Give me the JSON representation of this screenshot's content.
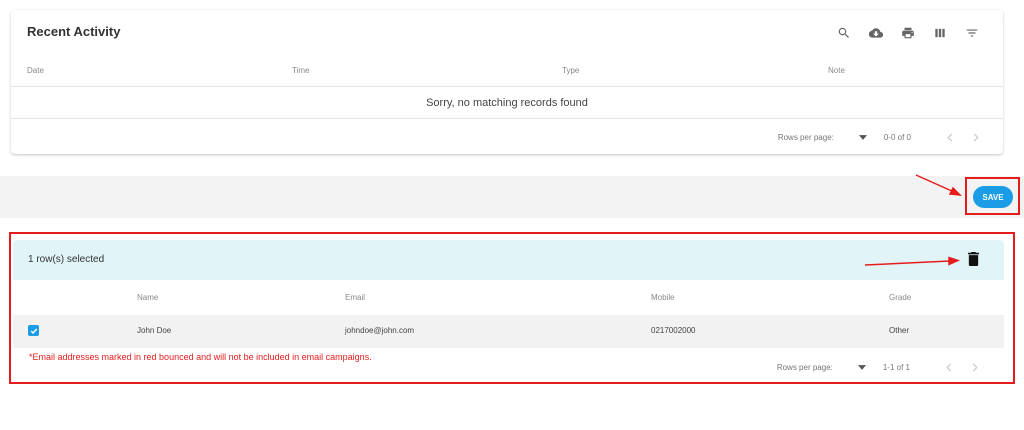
{
  "recent_activity": {
    "title": "Recent Activity",
    "toolbar_icons": [
      "search-icon",
      "cloud-download-icon",
      "print-icon",
      "view-columns-icon",
      "filter-icon"
    ],
    "columns": [
      "Date",
      "Time",
      "Type",
      "Note"
    ],
    "empty_message": "Sorry, no matching records found",
    "pagination": {
      "rows_per_page_label": "Rows per page:",
      "range": "0-0 of 0"
    }
  },
  "save": {
    "label": "SAVE",
    "color": "#1a9de6"
  },
  "selection": {
    "selected_text": "1 row(s) selected",
    "delete_icon": "trash-icon",
    "columns": [
      "Name",
      "Email",
      "Mobile",
      "Grade"
    ],
    "rows": [
      {
        "checked": true,
        "name": "John Doe",
        "email": "johndoe@john.com",
        "mobile": "0217002000",
        "grade": "Other"
      }
    ],
    "note": "*Email addresses marked in red bounced and will not be included in email campaigns.",
    "pagination": {
      "rows_per_page_label": "Rows per page:",
      "range": "1-1 of 1"
    }
  },
  "colors": {
    "annotation_red": "#e51c1c",
    "selection_banner": "#e1f5f8",
    "accent": "#1a9de6"
  }
}
